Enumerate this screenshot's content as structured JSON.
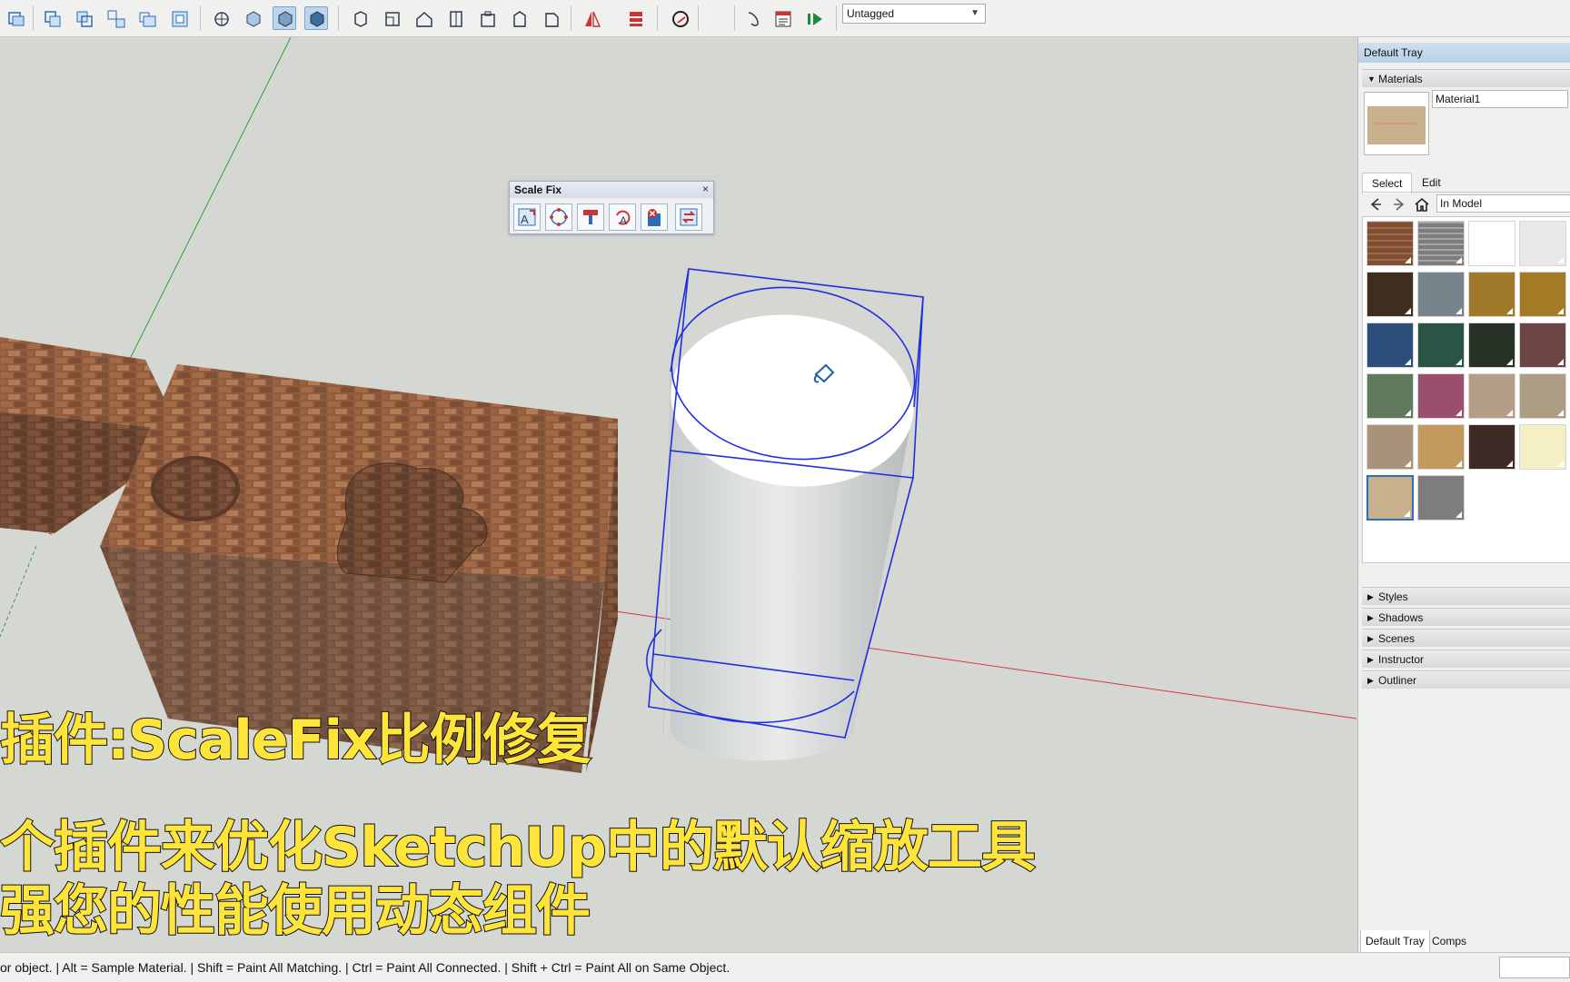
{
  "toolbar": {
    "tag_dropdown_value": "Untagged",
    "icons": [
      "select-icon",
      "component-icon",
      "group-icon",
      "explode-icon",
      "make-unique-icon",
      "outer-shell-icon",
      "xray-icon",
      "back-edges-icon",
      "wireframe-icon",
      "hidden-line-icon",
      "shaded-icon",
      "shaded-texture-icon",
      "iso-view-icon",
      "top-view-icon",
      "front-view-icon",
      "right-view-icon",
      "back-view-icon",
      "left-view-icon",
      "bottom-view-icon",
      "flip-icon",
      "align-icon",
      "orbit-icon",
      "lasso-icon",
      "report-icon",
      "run-icon"
    ]
  },
  "scale_fix": {
    "title": "Scale Fix",
    "close": "×",
    "buttons": [
      "scale-fix-icon",
      "center-scale-icon",
      "paint-scale-icon",
      "reset-scale-icon",
      "delete-scale-icon",
      "toggle-scale-icon"
    ]
  },
  "subtitles": {
    "line1": "插件:ScaleFix比例修复",
    "line2": "个插件来优化SketchUp中的默认缩放工具",
    "line3": "强您的性能使用动态组件"
  },
  "tray": {
    "title": "Default Tray",
    "materials_header": "Materials",
    "material_name": "Material1",
    "tabs": [
      "Select",
      "Edit"
    ],
    "collection": "In Model",
    "swatch_colors": [
      "#8a5a3a",
      "#8e8e8e",
      "#ffffff",
      "#e8e8e8",
      "#3f2e1f",
      "#77848c",
      "#a07a2a",
      "#a37a26",
      "#2b4f7a",
      "#2a5443",
      "#273126",
      "#6b4543",
      "#5f7a5c",
      "#9a4f6d",
      "#b49e88",
      "#ad9d85",
      "#a8937a",
      "#c39a5e",
      "#3d2a24",
      "#f4efc4",
      "#c8b08c",
      "#7c7d7c"
    ],
    "panels": [
      "Styles",
      "Shadows",
      "Scenes",
      "Instructor",
      "Outliner"
    ],
    "footer_tabs": [
      "Default Tray",
      "Comps"
    ]
  },
  "status_bar": {
    "text": "or object. | Alt = Sample Material. | Shift = Paint All Matching. | Ctrl = Paint All Connected. | Shift + Ctrl = Paint All on Same Object."
  }
}
